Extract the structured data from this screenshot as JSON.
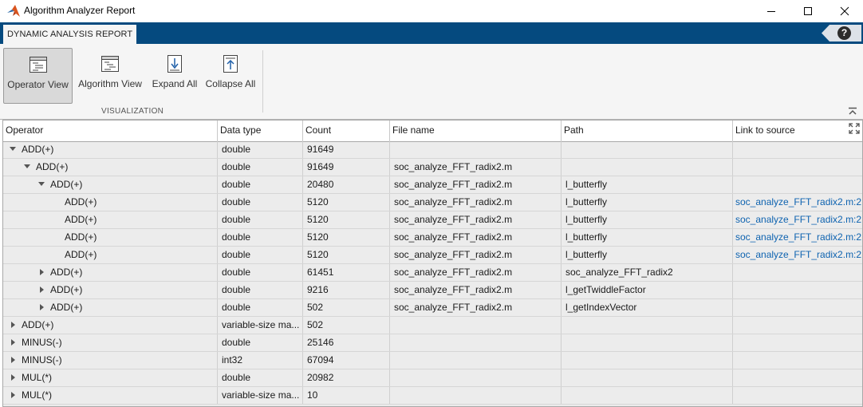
{
  "window": {
    "title": "Algorithm Analyzer Report"
  },
  "tabs": [
    {
      "label": "DYNAMIC ANALYSIS REPORT"
    }
  ],
  "help": {
    "label": "?"
  },
  "toolbar": {
    "buttons": [
      {
        "label": "Operator View",
        "selected": true
      },
      {
        "label": "Algorithm View"
      },
      {
        "label": "Expand All"
      },
      {
        "label": "Collapse All"
      }
    ],
    "section_label": "VISUALIZATION"
  },
  "table": {
    "columns": [
      "Operator",
      "Data type",
      "Count",
      "File name",
      "Path",
      "Link to source"
    ],
    "rows": [
      {
        "operator": "ADD(+)",
        "level": 0,
        "state": "open",
        "dtype": "double",
        "count": "91649",
        "file": "",
        "path": "",
        "link": ""
      },
      {
        "operator": "ADD(+)",
        "level": 1,
        "state": "open",
        "dtype": "double",
        "count": "91649",
        "file": "soc_analyze_FFT_radix2.m",
        "path": "",
        "link": ""
      },
      {
        "operator": "ADD(+)",
        "level": 2,
        "state": "open",
        "dtype": "double",
        "count": "20480",
        "file": "soc_analyze_FFT_radix2.m",
        "path": "l_butterfly",
        "link": ""
      },
      {
        "operator": "ADD(+)",
        "level": 3,
        "state": "leaf",
        "dtype": "double",
        "count": "5120",
        "file": "soc_analyze_FFT_radix2.m",
        "path": "l_butterfly",
        "link": "soc_analyze_FFT_radix2.m:2"
      },
      {
        "operator": "ADD(+)",
        "level": 3,
        "state": "leaf",
        "dtype": "double",
        "count": "5120",
        "file": "soc_analyze_FFT_radix2.m",
        "path": "l_butterfly",
        "link": "soc_analyze_FFT_radix2.m:2"
      },
      {
        "operator": "ADD(+)",
        "level": 3,
        "state": "leaf",
        "dtype": "double",
        "count": "5120",
        "file": "soc_analyze_FFT_radix2.m",
        "path": "l_butterfly",
        "link": "soc_analyze_FFT_radix2.m:2"
      },
      {
        "operator": "ADD(+)",
        "level": 3,
        "state": "leaf",
        "dtype": "double",
        "count": "5120",
        "file": "soc_analyze_FFT_radix2.m",
        "path": "l_butterfly",
        "link": "soc_analyze_FFT_radix2.m:2"
      },
      {
        "operator": "ADD(+)",
        "level": 2,
        "state": "closed",
        "dtype": "double",
        "count": "61451",
        "file": "soc_analyze_FFT_radix2.m",
        "path": "soc_analyze_FFT_radix2",
        "link": ""
      },
      {
        "operator": "ADD(+)",
        "level": 2,
        "state": "closed",
        "dtype": "double",
        "count": "9216",
        "file": "soc_analyze_FFT_radix2.m",
        "path": "l_getTwiddleFactor",
        "link": ""
      },
      {
        "operator": "ADD(+)",
        "level": 2,
        "state": "closed",
        "dtype": "double",
        "count": "502",
        "file": "soc_analyze_FFT_radix2.m",
        "path": "l_getIndexVector",
        "link": ""
      },
      {
        "operator": "ADD(+)",
        "level": 0,
        "state": "closed",
        "dtype": "variable-size ma...",
        "count": "502",
        "file": "",
        "path": "",
        "link": ""
      },
      {
        "operator": "MINUS(-)",
        "level": 0,
        "state": "closed",
        "dtype": "double",
        "count": "25146",
        "file": "",
        "path": "",
        "link": ""
      },
      {
        "operator": "MINUS(-)",
        "level": 0,
        "state": "closed",
        "dtype": "int32",
        "count": "67094",
        "file": "",
        "path": "",
        "link": ""
      },
      {
        "operator": "MUL(*)",
        "level": 0,
        "state": "closed",
        "dtype": "double",
        "count": "20982",
        "file": "",
        "path": "",
        "link": ""
      },
      {
        "operator": "MUL(*)",
        "level": 0,
        "state": "closed",
        "dtype": "variable-size ma...",
        "count": "10",
        "file": "",
        "path": "",
        "link": ""
      }
    ]
  },
  "colors": {
    "tab_bar": "#054a7f",
    "link": "#0e63b0",
    "logo": "#d9541e"
  }
}
